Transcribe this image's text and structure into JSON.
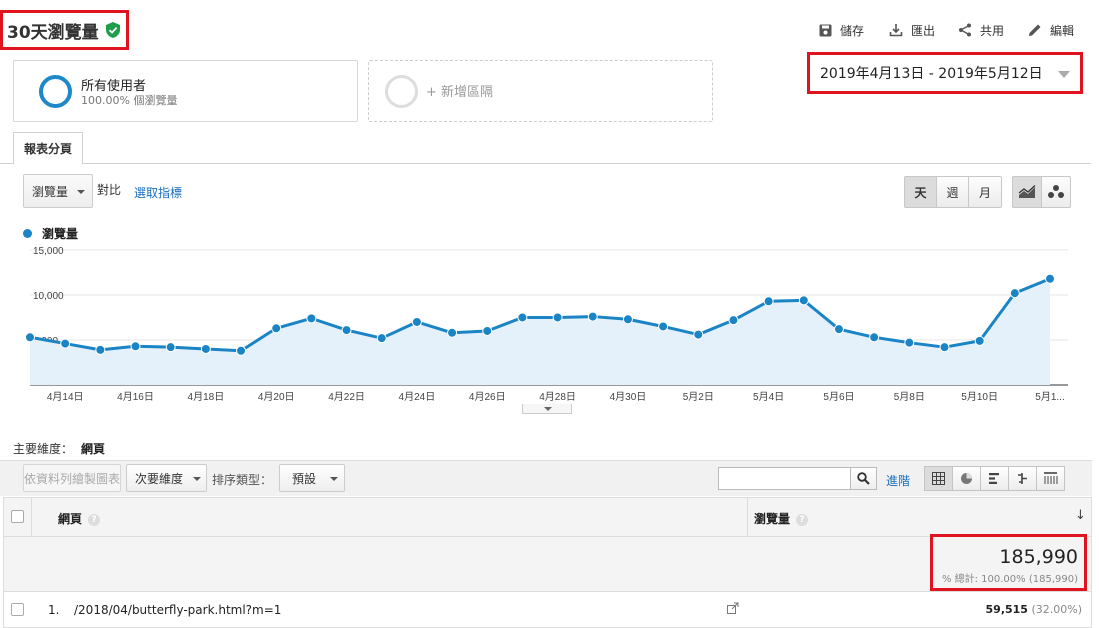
{
  "header": {
    "title": "30天瀏覽量",
    "toolbar": {
      "save": "儲存",
      "export": "匯出",
      "share": "共用",
      "edit": "編輯"
    }
  },
  "segments": {
    "all_users": {
      "title": "所有使用者",
      "subtitle": "100.00% 個瀏覽量"
    },
    "add_segment": "+ 新增區隔"
  },
  "date_range": "2019年4月13日 - 2019年5月12日",
  "tabs": [
    {
      "label": "報表分頁"
    }
  ],
  "chart_controls": {
    "metric": "瀏覽量",
    "versus": "對比",
    "pick_metric": "選取指標",
    "granularity": [
      "天",
      "週",
      "月"
    ]
  },
  "chart_data": {
    "type": "area",
    "series": [
      {
        "name": "瀏覽量",
        "values": [
          5300,
          4600,
          3900,
          4300,
          4200,
          4000,
          3800,
          6300,
          7400,
          6100,
          5200,
          7000,
          5800,
          6000,
          7500,
          7500,
          7600,
          7300,
          6500,
          5600,
          7200,
          9300,
          9400,
          6200,
          5300,
          4700,
          4200,
          4900,
          10200,
          11800
        ]
      }
    ],
    "x_tick_labels": [
      "4月14日",
      "4月16日",
      "4月18日",
      "4月20日",
      "4月22日",
      "4月24日",
      "4月26日",
      "4月28日",
      "4月30日",
      "5月2日",
      "5月4日",
      "5月6日",
      "5月8日",
      "5月10日",
      "5月1..."
    ],
    "y_tick_labels": [
      "5,000",
      "10,000",
      "15,000"
    ],
    "ylim": [
      0,
      15000
    ],
    "color": "#1a84c5",
    "fill": "#e4f1fb",
    "grid": true
  },
  "dimension": {
    "label": "主要維度：",
    "value": "網頁"
  },
  "table_toolbar": {
    "plot_rows": "依資料列繪製圖表",
    "secondary_dimension": "次要維度",
    "sort_label": "排序類型：",
    "sort_value": "預設",
    "search_placeholder": "",
    "advanced": "進階"
  },
  "table": {
    "columns": [
      "網頁",
      "瀏覽量"
    ],
    "help_glyph": "?",
    "sort_glyph": "↓",
    "total": {
      "value": "185,990",
      "pct": "% 總計: 100.00% (185,990)"
    },
    "rows": [
      {
        "num": "1.",
        "page": "/2018/04/butterfly-park.html?m=1",
        "value": "59,515",
        "pct": "(32.00%)"
      }
    ]
  }
}
